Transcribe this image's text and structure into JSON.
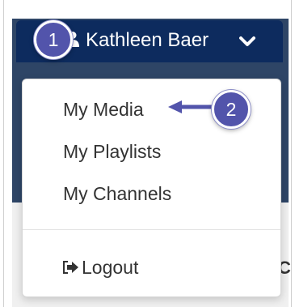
{
  "user_menu": {
    "username": "Kathleen Baer",
    "user_icon": "user-icon",
    "toggle_icon": "chevron-down-icon"
  },
  "dropdown": {
    "items": [
      {
        "label": "My Media"
      },
      {
        "label": "My Playlists"
      },
      {
        "label": "My Channels"
      }
    ],
    "logout": {
      "label": "Logout",
      "icon": "sign-out-icon"
    }
  },
  "callouts": {
    "step1": "1",
    "step2": "2"
  },
  "background_partial_text": "C",
  "colors": {
    "header_bg": "#0d2b5e",
    "callout": "#5254ab",
    "arrow": "#5254ab"
  }
}
